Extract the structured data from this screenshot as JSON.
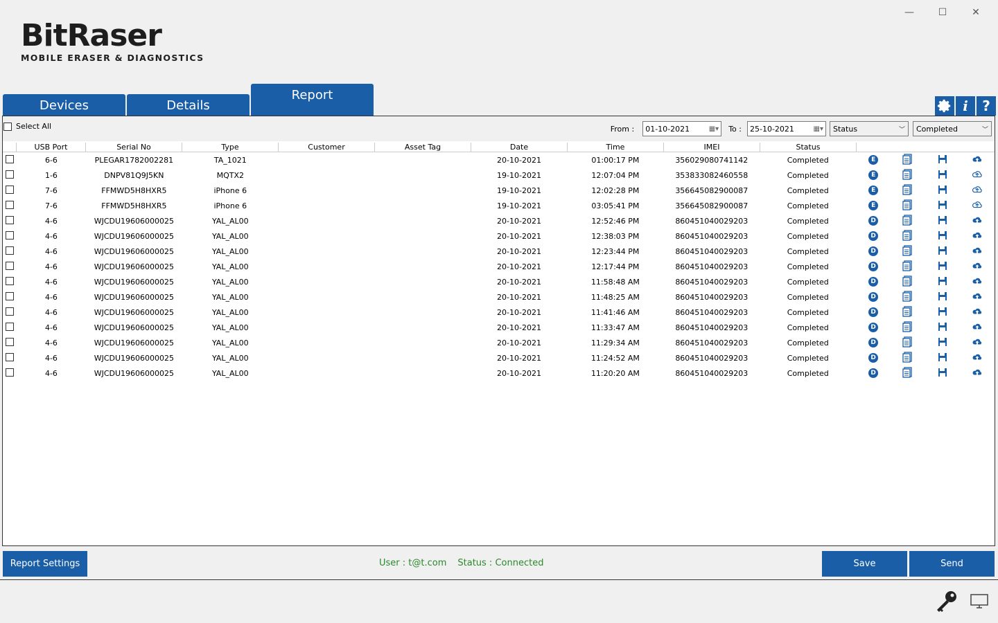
{
  "window": {
    "min": "—",
    "max": "☐",
    "close": "✕"
  },
  "logo": {
    "main": "BitRaser",
    "sub": "MOBILE ERASER & DIAGNOSTICS"
  },
  "tabs": [
    {
      "label": "Devices"
    },
    {
      "label": "Details"
    },
    {
      "label": "Report"
    }
  ],
  "select_all_label": "Select All",
  "filters": {
    "from_label": "From :",
    "from_value": "01-10-2021",
    "to_label": "To :",
    "to_value": "25-10-2021",
    "status_select": "Status",
    "value_select": "Completed"
  },
  "columns": [
    "USB Port",
    "Serial No",
    "Type",
    "Customer",
    "Asset Tag",
    "Date",
    "Time",
    "IMEI",
    "Status"
  ],
  "rows": [
    {
      "usb": "6-6",
      "serial": "PLEGAR1782002281",
      "type": "TA_1021",
      "customer": "",
      "asset": "",
      "date": "20-10-2021",
      "time": "01:00:17 PM",
      "imei": "356029080741142",
      "status": "Completed",
      "badge": "E",
      "upload": "solid"
    },
    {
      "usb": "1-6",
      "serial": "DNPV81Q9J5KN",
      "type": "MQTX2",
      "customer": "",
      "asset": "",
      "date": "19-10-2021",
      "time": "12:07:04 PM",
      "imei": "353833082460558",
      "status": "Completed",
      "badge": "E",
      "upload": "outline"
    },
    {
      "usb": "7-6",
      "serial": "FFMWD5H8HXR5",
      "type": "iPhone 6",
      "customer": "",
      "asset": "",
      "date": "19-10-2021",
      "time": "12:02:28 PM",
      "imei": "356645082900087",
      "status": "Completed",
      "badge": "E",
      "upload": "outline"
    },
    {
      "usb": "7-6",
      "serial": "FFMWD5H8HXR5",
      "type": "iPhone 6",
      "customer": "",
      "asset": "",
      "date": "19-10-2021",
      "time": "03:05:41 PM",
      "imei": "356645082900087",
      "status": "Completed",
      "badge": "E",
      "upload": "outline"
    },
    {
      "usb": "4-6",
      "serial": "WJCDU19606000025",
      "type": "YAL_AL00",
      "customer": "",
      "asset": "",
      "date": "20-10-2021",
      "time": "12:52:46 PM",
      "imei": "860451040029203",
      "status": "Completed",
      "badge": "D",
      "upload": "solid"
    },
    {
      "usb": "4-6",
      "serial": "WJCDU19606000025",
      "type": "YAL_AL00",
      "customer": "",
      "asset": "",
      "date": "20-10-2021",
      "time": "12:38:03 PM",
      "imei": "860451040029203",
      "status": "Completed",
      "badge": "D",
      "upload": "solid"
    },
    {
      "usb": "4-6",
      "serial": "WJCDU19606000025",
      "type": "YAL_AL00",
      "customer": "",
      "asset": "",
      "date": "20-10-2021",
      "time": "12:23:44 PM",
      "imei": "860451040029203",
      "status": "Completed",
      "badge": "D",
      "upload": "solid"
    },
    {
      "usb": "4-6",
      "serial": "WJCDU19606000025",
      "type": "YAL_AL00",
      "customer": "",
      "asset": "",
      "date": "20-10-2021",
      "time": "12:17:44 PM",
      "imei": "860451040029203",
      "status": "Completed",
      "badge": "D",
      "upload": "solid"
    },
    {
      "usb": "4-6",
      "serial": "WJCDU19606000025",
      "type": "YAL_AL00",
      "customer": "",
      "asset": "",
      "date": "20-10-2021",
      "time": "11:58:48 AM",
      "imei": "860451040029203",
      "status": "Completed",
      "badge": "D",
      "upload": "solid"
    },
    {
      "usb": "4-6",
      "serial": "WJCDU19606000025",
      "type": "YAL_AL00",
      "customer": "",
      "asset": "",
      "date": "20-10-2021",
      "time": "11:48:25 AM",
      "imei": "860451040029203",
      "status": "Completed",
      "badge": "D",
      "upload": "solid"
    },
    {
      "usb": "4-6",
      "serial": "WJCDU19606000025",
      "type": "YAL_AL00",
      "customer": "",
      "asset": "",
      "date": "20-10-2021",
      "time": "11:41:46 AM",
      "imei": "860451040029203",
      "status": "Completed",
      "badge": "D",
      "upload": "solid"
    },
    {
      "usb": "4-6",
      "serial": "WJCDU19606000025",
      "type": "YAL_AL00",
      "customer": "",
      "asset": "",
      "date": "20-10-2021",
      "time": "11:33:47 AM",
      "imei": "860451040029203",
      "status": "Completed",
      "badge": "D",
      "upload": "solid"
    },
    {
      "usb": "4-6",
      "serial": "WJCDU19606000025",
      "type": "YAL_AL00",
      "customer": "",
      "asset": "",
      "date": "20-10-2021",
      "time": "11:29:34 AM",
      "imei": "860451040029203",
      "status": "Completed",
      "badge": "D",
      "upload": "solid"
    },
    {
      "usb": "4-6",
      "serial": "WJCDU19606000025",
      "type": "YAL_AL00",
      "customer": "",
      "asset": "",
      "date": "20-10-2021",
      "time": "11:24:52 AM",
      "imei": "860451040029203",
      "status": "Completed",
      "badge": "D",
      "upload": "solid"
    },
    {
      "usb": "4-6",
      "serial": "WJCDU19606000025",
      "type": "YAL_AL00",
      "customer": "",
      "asset": "",
      "date": "20-10-2021",
      "time": "11:20:20 AM",
      "imei": "860451040029203",
      "status": "Completed",
      "badge": "D",
      "upload": "solid"
    }
  ],
  "bottom": {
    "report_settings": "Report Settings",
    "user": "User : t@t.com",
    "status": "Status : Connected",
    "save": "Save",
    "send": "Send"
  },
  "colors": {
    "accent": "#1a5ea8",
    "status_green": "#2a8a2a"
  }
}
